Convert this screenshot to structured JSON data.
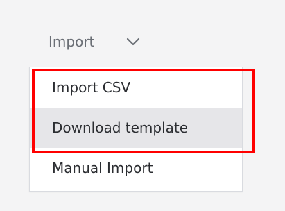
{
  "import_dropdown": {
    "label": "Import",
    "icon": "chevron-down-icon"
  },
  "menu": {
    "items": [
      {
        "label": "Import CSV"
      },
      {
        "label": "Download template"
      },
      {
        "label": "Manual Import"
      }
    ],
    "hovered_index": 1
  },
  "annotation": {
    "highlight_color": "#ff0000"
  }
}
